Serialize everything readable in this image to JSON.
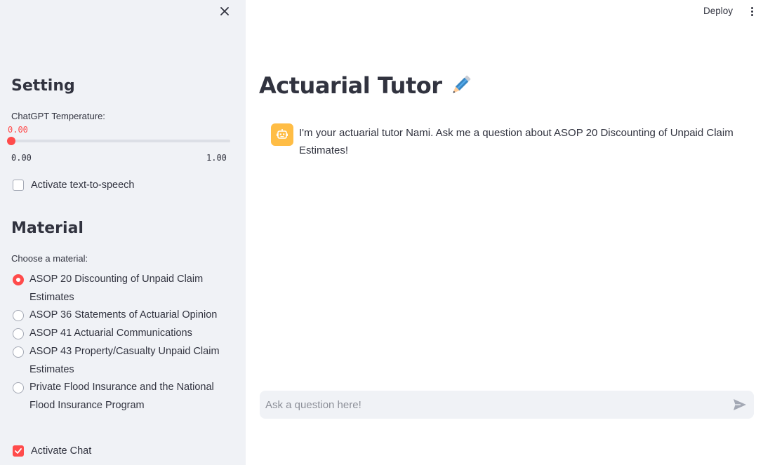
{
  "sidebar": {
    "close_icon": "close-icon",
    "setting": {
      "heading": "Setting",
      "temperature_label": "ChatGPT Temperature:",
      "temperature_value": "0.00",
      "temperature_min": "0.00",
      "temperature_max": "1.00",
      "tts_label": "Activate text-to-speech",
      "tts_checked": false
    },
    "material": {
      "heading": "Material",
      "choose_label": "Choose a material:",
      "options": [
        {
          "label": "ASOP 20 Discounting of Unpaid Claim Estimates",
          "selected": true
        },
        {
          "label": "ASOP 36 Statements of Actuarial Opinion",
          "selected": false
        },
        {
          "label": "ASOP 41 Actuarial Communications",
          "selected": false
        },
        {
          "label": "ASOP 43 Property/Casualty Unpaid Claim Estimates",
          "selected": false
        },
        {
          "label": "Private Flood Insurance and the National Flood Insurance Program",
          "selected": false
        }
      ]
    },
    "activate_chat_label": "Activate Chat",
    "activate_chat_checked": true
  },
  "header": {
    "deploy_label": "Deploy",
    "menu_icon": "more-vertical-icon"
  },
  "main": {
    "title": "Actuarial Tutor",
    "title_icon": "pencil-icon",
    "messages": [
      {
        "role": "assistant",
        "avatar_icon": "bot-icon",
        "text": "I'm your actuarial tutor Nami. Ask me a question about ASOP 20 Discounting of Unpaid Claim Estimates!"
      }
    ],
    "chat_input": {
      "placeholder": "Ask a question here!",
      "value": "",
      "send_icon": "send-icon"
    }
  },
  "colors": {
    "accent": "#ff4b4b",
    "sidebar_bg": "#f0f2f6",
    "avatar_bg": "#ffbd45",
    "text": "#31333f"
  }
}
